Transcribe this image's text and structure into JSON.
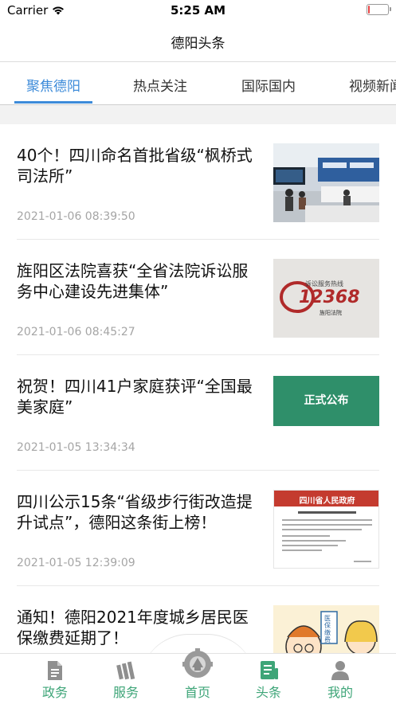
{
  "status_bar": {
    "carrier": "Carrier",
    "time": "5:25 AM",
    "battery_level": 0.1,
    "battery_color": "#e64545"
  },
  "nav": {
    "title": "德阳头条"
  },
  "tabs": [
    {
      "label": "聚焦德阳",
      "active": true
    },
    {
      "label": "热点关注",
      "active": false
    },
    {
      "label": "国际国内",
      "active": false
    },
    {
      "label": "视频新闻",
      "active": false
    }
  ],
  "accent_color": "#3d8bd9",
  "articles": [
    {
      "title": "40个！四川命名首批省级“枫桥式司法所”",
      "time": "2021-01-06 08:39:50",
      "thumb": "photo-judicial-office"
    },
    {
      "title": "旌阳区法院喜获“全省法院诉讼服务中心建设先进集体”",
      "time": "2021-01-06 08:45:27",
      "thumb": "photo-12368-hotline-sign",
      "thumb_text": {
        "line1": "诉讼服务热线",
        "number": "12368",
        "line2": "旌阳法院"
      }
    },
    {
      "title": "祝贺！四川41户家庭获评“全国最美家庭”",
      "time": "2021-01-05 13:34:34",
      "thumb": "green-announcement-banner",
      "thumb_text": {
        "label": "正式公布"
      }
    },
    {
      "title": "四川公示15条“省级步行街改造提升试点”，德阳这条街上榜！",
      "time": "2021-01-05 12:39:09",
      "thumb": "government-notice-document",
      "thumb_text": {
        "header": "四川省人民政府"
      }
    },
    {
      "title": "通知！德阳2021年度城乡居民医保缴费延期了！",
      "time": "",
      "thumb": "medical-insurance-cartoon",
      "thumb_text": {
        "label": "医保缴费"
      }
    }
  ],
  "tabbar": {
    "color": "#3ea578",
    "items": [
      {
        "label": "政务",
        "icon": "document-icon"
      },
      {
        "label": "服务",
        "icon": "books-icon"
      },
      {
        "label": "首页",
        "icon": "home-gear-icon"
      },
      {
        "label": "头条",
        "icon": "news-icon"
      },
      {
        "label": "我的",
        "icon": "person-icon"
      }
    ]
  }
}
